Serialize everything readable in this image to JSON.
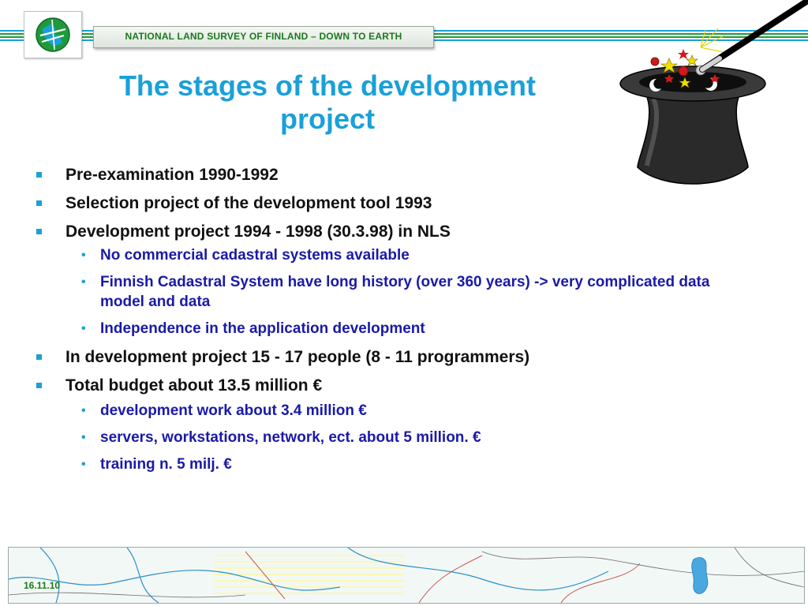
{
  "header": {
    "banner_text": "NATIONAL LAND SURVEY OF FINLAND – DOWN TO EARTH",
    "colors": {
      "stripe_blue": "#1aa0d8",
      "stripe_green": "#1f9a3a",
      "banner_text": "#1a7a1a"
    }
  },
  "logo": {
    "icon": "nls-globe-logo-icon"
  },
  "slide": {
    "title_line1": "The stages of the development",
    "title_line2": "project",
    "colors": {
      "title": "#1aa0d8",
      "level1_text": "#111111",
      "level2_text": "#1a1aa8",
      "bullet": "#1aa0d8"
    }
  },
  "bullets": {
    "b1": "Pre-examination 1990-1992",
    "b2": "Selection project of the development tool 1993",
    "b3": "Development project 1994 - 1998 (30.3.98) in  NLS",
    "b3_sub1": "No commercial cadastral systems available",
    "b3_sub2": "Finnish Cadastral System have long history (over 360 years) -> very complicated data model and data",
    "b3_sub3": "Independence in the application development",
    "b4": "In development project 15 - 17 people  (8 - 11 programmers)",
    "b5": "Total budget about 13.5 million €",
    "b5_sub1": "development work about 3.4 million €",
    "b5_sub2": "servers, workstations, network, ect. about 5 million. €",
    "b5_sub3": "training n. 5 milj. €"
  },
  "decoration": {
    "icon": "magic-hat-wand-icon"
  },
  "footer": {
    "date": "16.11.10",
    "map_icon": "map-strip-icon"
  }
}
